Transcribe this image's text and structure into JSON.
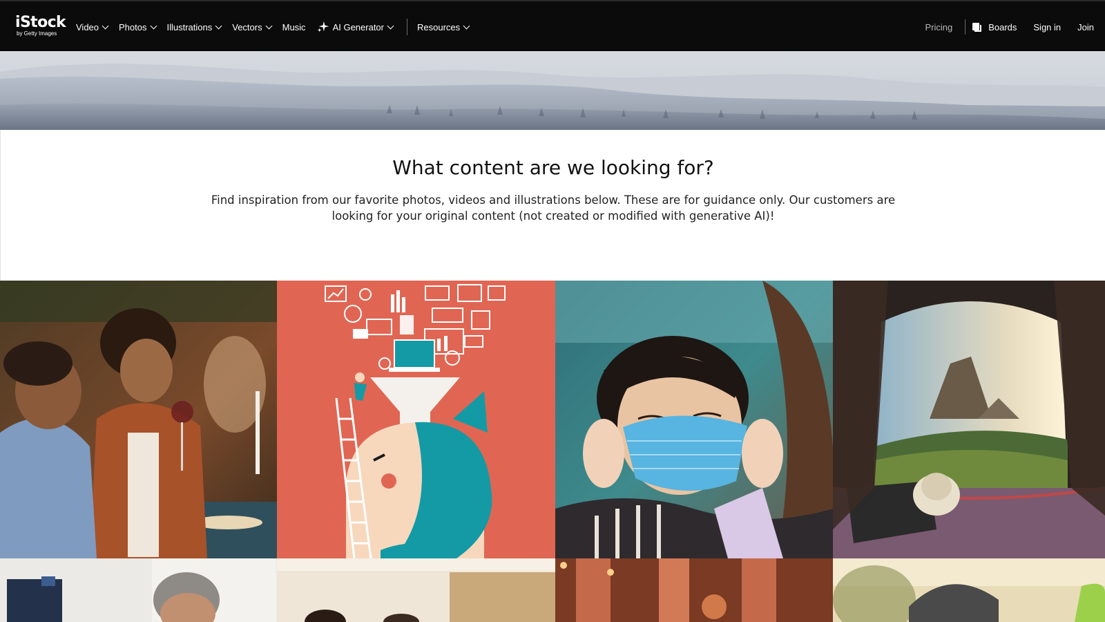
{
  "header": {
    "logo": {
      "name": "iStock",
      "tagline": "by Getty Images"
    },
    "nav": [
      {
        "label": "Video",
        "dropdown": true
      },
      {
        "label": "Photos",
        "dropdown": true
      },
      {
        "label": "Illustrations",
        "dropdown": true
      },
      {
        "label": "Vectors",
        "dropdown": true
      },
      {
        "label": "Music",
        "dropdown": false
      },
      {
        "label": "AI Generator",
        "dropdown": true,
        "icon": "sparkle-icon"
      },
      {
        "label": "Resources",
        "dropdown": true
      }
    ],
    "right": {
      "pricing": "Pricing",
      "boards": "Boards",
      "sign_in": "Sign in",
      "join": "Join"
    }
  },
  "hero": {
    "image": "snowy-forest-landscape"
  },
  "intro": {
    "title": "What content are we looking for?",
    "text": "Find inspiration from our favorite photos, videos and illustrations below. These are for guidance only. Our customers are looking for your original content (not created or modified with generative AI)!"
  },
  "gallery": [
    {
      "subject": "friends-dinner-party-photo"
    },
    {
      "subject": "data-funnel-illustration"
    },
    {
      "subject": "girl-face-mask-photo"
    },
    {
      "subject": "tent-view-landscape-photo"
    },
    {
      "subject": "man-at-desk-photo"
    },
    {
      "subject": "living-room-photo"
    },
    {
      "subject": "lanterns-photo"
    },
    {
      "subject": "cyclist-helmet-photo"
    }
  ],
  "colors": {
    "nav_bg": "#0b0b0b",
    "illustration_bg": "#e06653",
    "teal": "#149aa5"
  }
}
